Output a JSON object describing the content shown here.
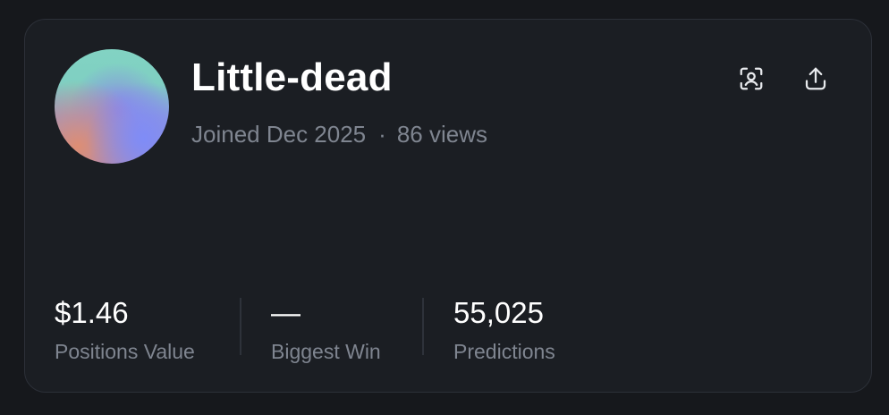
{
  "profile": {
    "username": "Little-dead",
    "joined": "Joined Dec 2025",
    "separator": "·",
    "views": "86 views"
  },
  "actions": [
    {
      "icon": "profile-scan-icon"
    },
    {
      "icon": "share-upload-icon"
    }
  ],
  "stats": [
    {
      "value": "$1.46",
      "label": "Positions Value"
    },
    {
      "value": "—",
      "label": "Biggest Win"
    },
    {
      "value": "55,025",
      "label": "Predictions"
    }
  ],
  "colors": {
    "background": "#16181c",
    "card": "#1b1e23",
    "border": "#2c3038",
    "text_primary": "#ffffff",
    "text_secondary": "#7f8590"
  }
}
